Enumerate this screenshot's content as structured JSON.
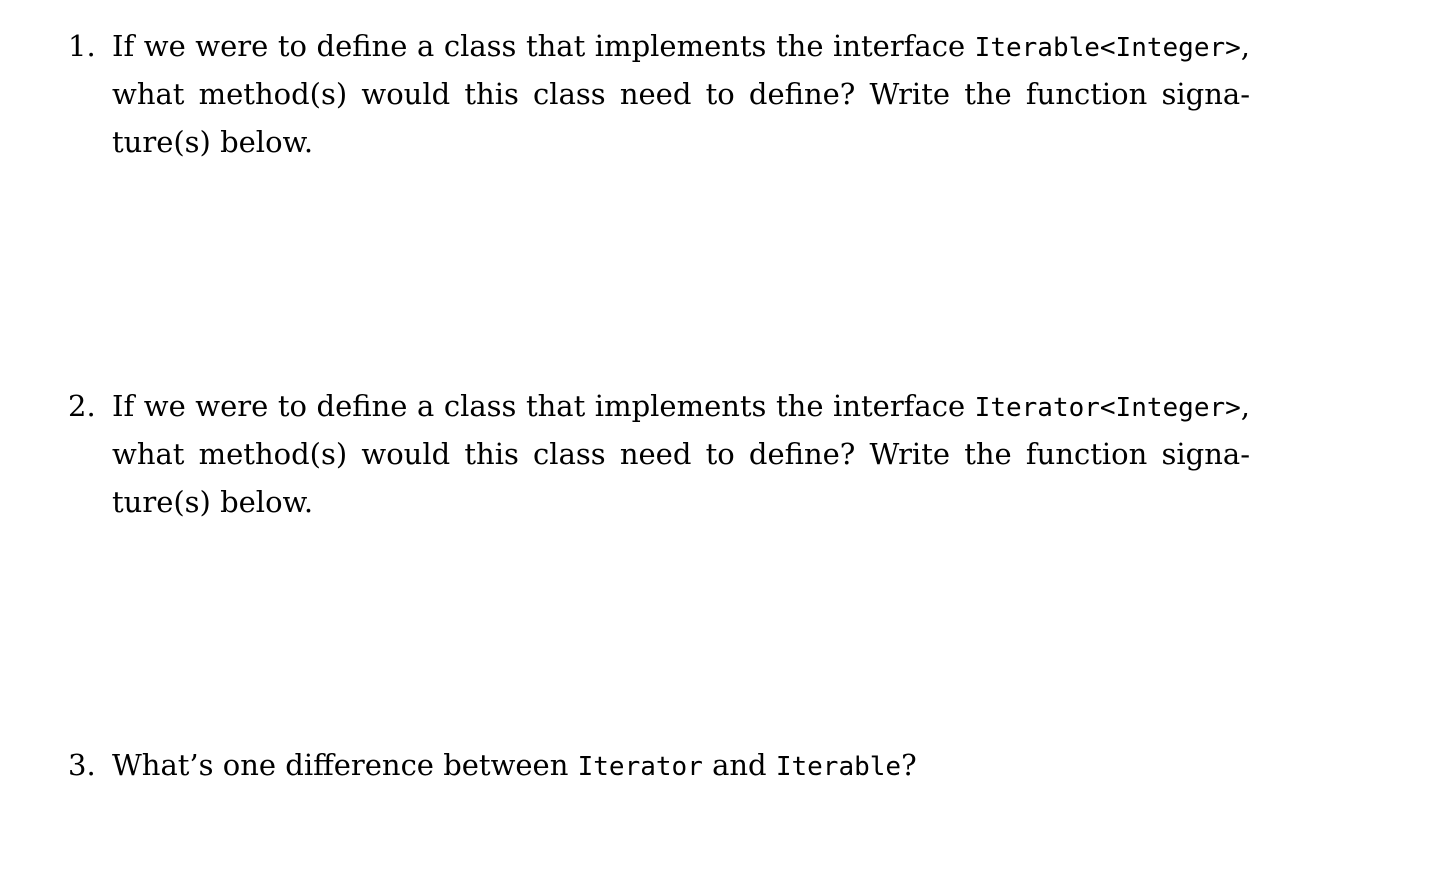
{
  "questions": [
    {
      "number": "1.",
      "line1_pre": "If we were to define a class that implements the interface ",
      "line1_code": "Iterable<Integer>",
      "line1_post": ",",
      "line2": "what method(s) would this class need to define?  Write the function signa-",
      "line3": "ture(s) below."
    },
    {
      "number": "2.",
      "line1_pre": "If we were to define a class that implements the interface ",
      "line1_code": "Iterator<Integer>",
      "line1_post": ",",
      "line2": "what method(s) would this class need to define?  Write the function signa-",
      "line3": "ture(s) below."
    },
    {
      "number": "3.",
      "text_pre": "What’s one difference between ",
      "code_a": "Iterator",
      "text_mid": " and ",
      "code_b": "Iterable",
      "text_post": "?"
    }
  ]
}
